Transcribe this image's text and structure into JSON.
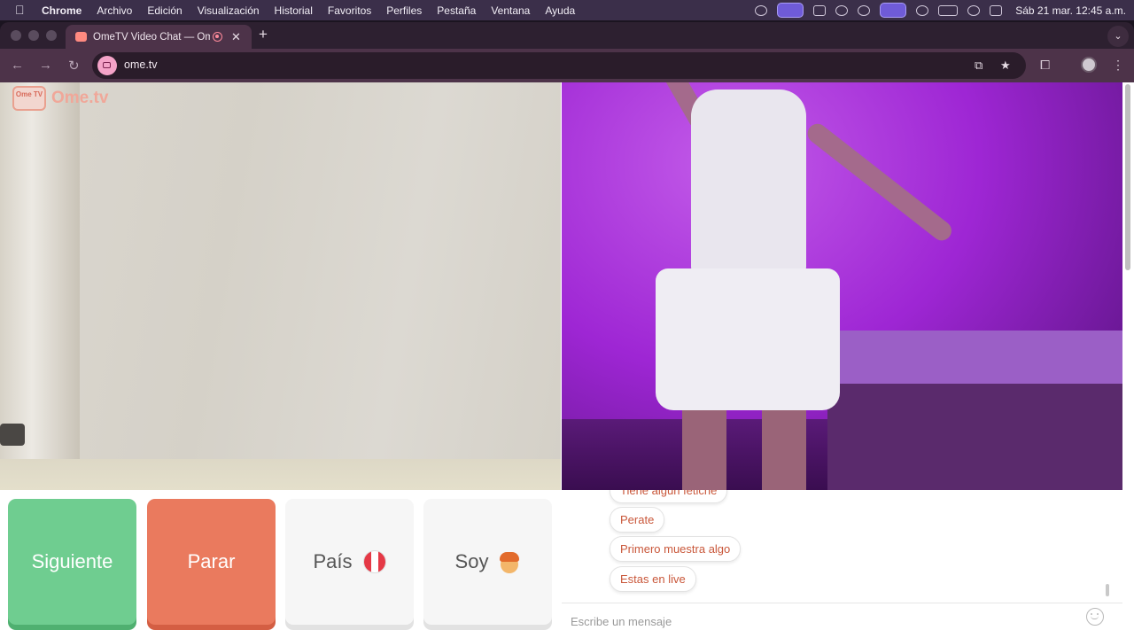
{
  "menubar": {
    "app_name": "Chrome",
    "menus": [
      "Archivo",
      "Edición",
      "Visualización",
      "Historial",
      "Favoritos",
      "Perfiles",
      "Pestaña",
      "Ventana",
      "Ayuda"
    ],
    "clock": "Sáb 21 mar.  12:45 a.m."
  },
  "browser": {
    "tab_title": "OmeTV Video Chat — Ome",
    "url": "ome.tv"
  },
  "site": {
    "logo_badge": "Ome TV",
    "logo_text": "Ome.tv"
  },
  "controls": {
    "next_label": "Siguiente",
    "stop_label": "Parar",
    "country_label": "País",
    "gender_label": "Soy"
  },
  "chat": {
    "messages": [
      "Tiene algún fetiche",
      "Perate",
      "Primero muestra algo",
      "Estas en live"
    ],
    "input_placeholder": "Escribe un mensaje"
  },
  "colors": {
    "next": "#6fcd90",
    "stop": "#ea7a5e",
    "accent_text": "#c9573a"
  }
}
